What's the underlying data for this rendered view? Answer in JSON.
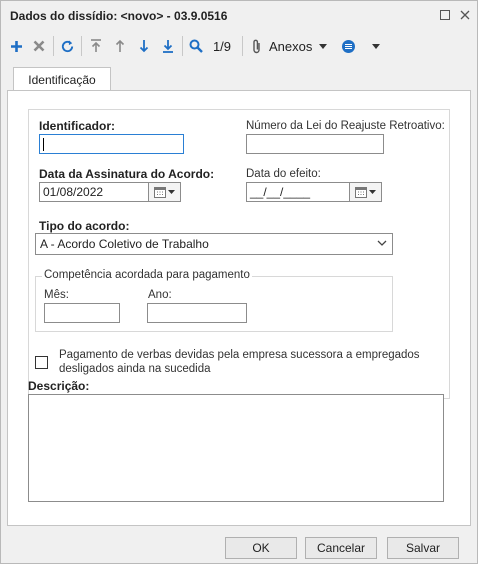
{
  "window": {
    "title": "Dados do dissídio: <novo> - 03.9.0516",
    "maximize_icon": "square-icon",
    "close_icon": "x-icon"
  },
  "toolbar": {
    "add_icon": "plus-icon",
    "delete_icon": "x-icon",
    "refresh_icon": "refresh-icon",
    "first_icon": "first-icon",
    "prev_icon": "arrow-up-icon",
    "next_icon": "arrow-down-icon",
    "last_icon": "last-icon",
    "search_icon": "search-icon",
    "record_counter": "1/9",
    "attachments_label": "Anexos",
    "colors": {
      "blue": "#1f6fc5",
      "gray": "#8a8a8a",
      "green": "#2d8b3c"
    }
  },
  "tabs": [
    {
      "label": "Identificação",
      "active": true
    }
  ],
  "form": {
    "identificador": {
      "label": "Identificador:",
      "value": ""
    },
    "numero_lei": {
      "label": "Número da Lei do Reajuste Retroativo:",
      "value": ""
    },
    "data_assinatura": {
      "label": "Data da Assinatura do Acordo:",
      "value": "01/08/2022"
    },
    "data_efeito": {
      "label": "Data do efeito:",
      "value": "__/__/____"
    },
    "tipo_acordo": {
      "label": "Tipo do acordo:",
      "value": "A - Acordo Coletivo de Trabalho"
    },
    "competencia": {
      "legend": "Competência acordada para pagamento",
      "mes": {
        "label": "Mês:",
        "value": ""
      },
      "ano": {
        "label": "Ano:",
        "value": ""
      }
    },
    "pagamento_verbas": {
      "label_line1": "Pagamento de verbas devidas pela empresa sucessora a empregados",
      "label_line2": "desligados ainda na sucedida",
      "checked": false
    },
    "descricao": {
      "label": "Descrição:",
      "value": ""
    }
  },
  "footer": {
    "ok_label": "OK",
    "cancel_label": "Cancelar",
    "save_label": "Salvar"
  }
}
